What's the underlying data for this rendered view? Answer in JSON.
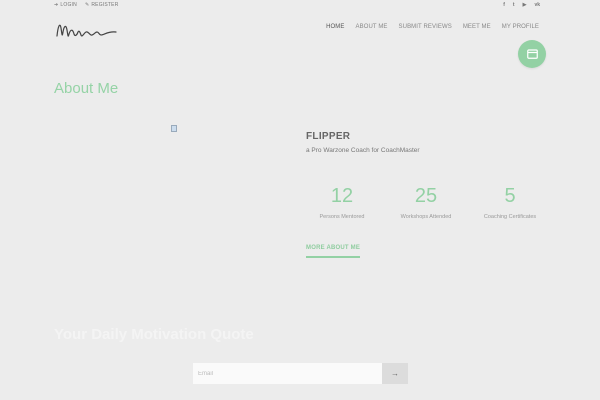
{
  "topbar": {
    "login_label": "LOGIN",
    "register_label": "REGISTER"
  },
  "social": {
    "icons": [
      "facebook-icon",
      "twitter-icon",
      "youtube-icon",
      "vk-icon"
    ],
    "glyphs": [
      "f",
      "t",
      "▶",
      "vk"
    ]
  },
  "logo": {
    "text": "Melira"
  },
  "nav": {
    "items": [
      {
        "label": "HOME",
        "active": true
      },
      {
        "label": "ABOUT ME",
        "active": false
      },
      {
        "label": "SUBMIT REVIEWS",
        "active": false
      },
      {
        "label": "MEET ME",
        "active": false
      },
      {
        "label": "MY PROFILE",
        "active": false
      }
    ]
  },
  "about": {
    "title": "About Me",
    "name": "FLIPPER",
    "subtitle": "a Pro Warzone Coach for CoachMaster",
    "stats": [
      {
        "value": "12",
        "label": "Persons Mentored"
      },
      {
        "value": "25",
        "label": "Workshops Attended"
      },
      {
        "value": "5",
        "label": "Coaching Certificates"
      }
    ],
    "more_label": "MORE ABOUT ME"
  },
  "quote": {
    "title": "Your Daily Motivation Quote"
  },
  "subscribe": {
    "email_placeholder": "Email",
    "submit_glyph": "→"
  },
  "colors": {
    "accent": "#93d1a4",
    "background": "#ececec"
  }
}
